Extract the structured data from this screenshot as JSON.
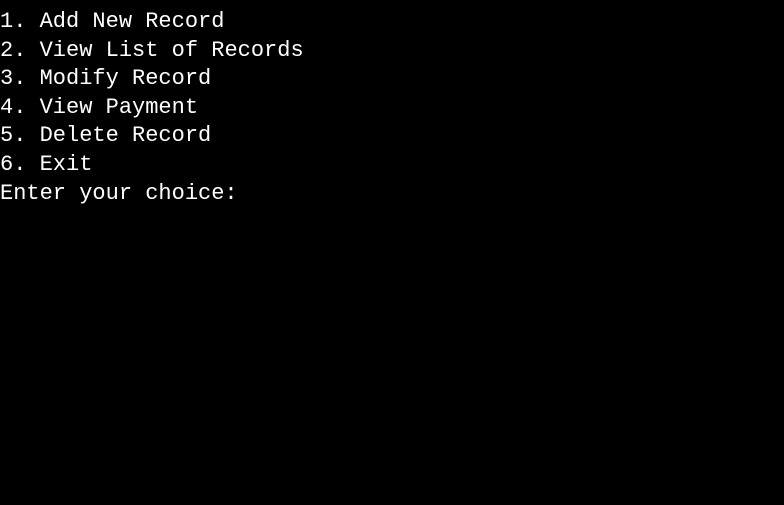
{
  "menu": {
    "items": [
      {
        "number": "1",
        "label": "Add New Record"
      },
      {
        "number": "2",
        "label": "View List of Records"
      },
      {
        "number": "3",
        "label": "Modify Record"
      },
      {
        "number": "4",
        "label": "View Payment"
      },
      {
        "number": "5",
        "label": "Delete Record"
      },
      {
        "number": "6",
        "label": "Exit"
      }
    ],
    "prompt": "Enter your choice:",
    "input_value": ""
  }
}
